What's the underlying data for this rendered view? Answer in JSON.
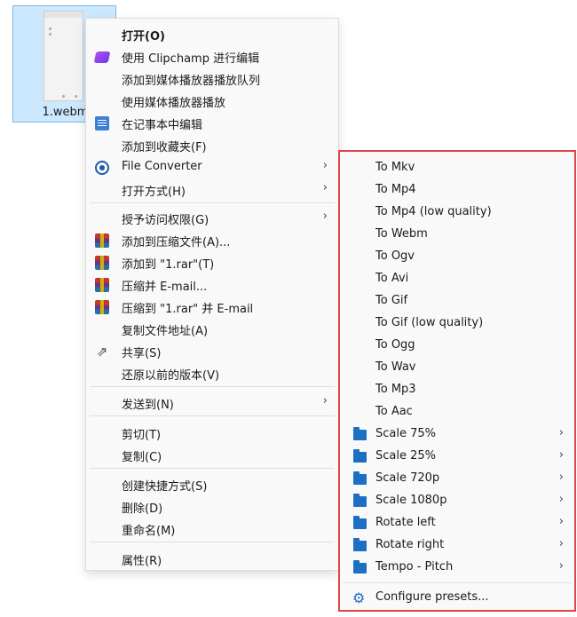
{
  "file": {
    "name": "1.webm"
  },
  "context_menu": {
    "items": [
      {
        "label": "打开(O)"
      },
      {
        "label": "使用 Clipchamp 进行编辑"
      },
      {
        "label": "添加到媒体播放器播放队列"
      },
      {
        "label": "使用媒体播放器播放"
      },
      {
        "label": "在记事本中编辑"
      },
      {
        "label": "添加到收藏夹(F)"
      },
      {
        "label": "File Converter"
      },
      {
        "label": "打开方式(H)"
      },
      {
        "label": "授予访问权限(G)"
      },
      {
        "label": "添加到压缩文件(A)..."
      },
      {
        "label": "添加到 \"1.rar\"(T)"
      },
      {
        "label": "压缩并 E-mail..."
      },
      {
        "label": "压缩到 \"1.rar\" 并 E-mail"
      },
      {
        "label": "复制文件地址(A)"
      },
      {
        "label": "共享(S)"
      },
      {
        "label": "还原以前的版本(V)"
      },
      {
        "label": "发送到(N)"
      },
      {
        "label": "剪切(T)"
      },
      {
        "label": "复制(C)"
      },
      {
        "label": "创建快捷方式(S)"
      },
      {
        "label": "删除(D)"
      },
      {
        "label": "重命名(M)"
      },
      {
        "label": "属性(R)"
      }
    ],
    "arrow": "›"
  },
  "file_converter_menu": {
    "items": [
      {
        "label": "To Mkv"
      },
      {
        "label": "To Mp4"
      },
      {
        "label": "To Mp4 (low quality)"
      },
      {
        "label": "To Webm"
      },
      {
        "label": "To Ogv"
      },
      {
        "label": "To Avi"
      },
      {
        "label": "To Gif"
      },
      {
        "label": "To Gif (low quality)"
      },
      {
        "label": "To Ogg"
      },
      {
        "label": "To Wav"
      },
      {
        "label": "To Mp3"
      },
      {
        "label": "To Aac"
      },
      {
        "label": "Scale 75%"
      },
      {
        "label": "Scale 25%"
      },
      {
        "label": "Scale 720p"
      },
      {
        "label": "Scale 1080p"
      },
      {
        "label": "Rotate left"
      },
      {
        "label": "Rotate right"
      },
      {
        "label": "Tempo - Pitch"
      },
      {
        "label": "Configure presets..."
      }
    ]
  },
  "colors": {
    "selection": "#cce8ff",
    "highlight_border": "#e04444",
    "folder": "#1d6fc4"
  }
}
